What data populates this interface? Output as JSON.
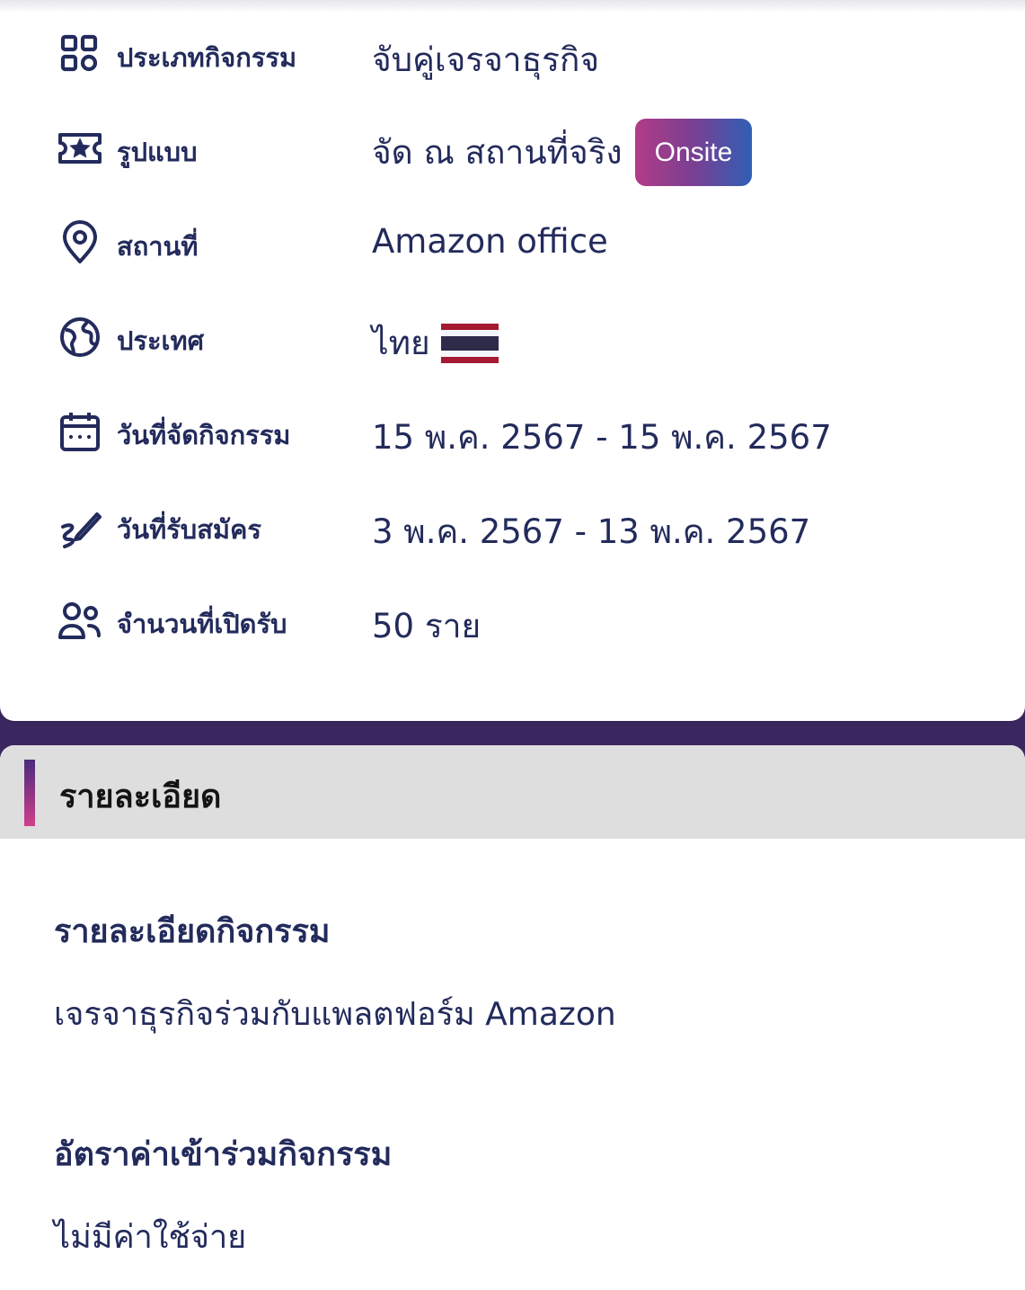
{
  "info": {
    "rows": [
      {
        "icon": "grid-icon",
        "label": "ประเภทกิจกรรม",
        "value": "จับคู่เจรจาธุรกิจ"
      },
      {
        "icon": "ticket-star-icon",
        "label": "รูปแบบ",
        "value": "จัด ณ สถานที่จริง",
        "badge": "Onsite"
      },
      {
        "icon": "location-pin-icon",
        "label": "สถานที่",
        "value": "Amazon office"
      },
      {
        "icon": "globe-icon",
        "label": "ประเทศ",
        "value": "ไทย"
      },
      {
        "icon": "calendar-icon",
        "label": "วันที่จัดกิจกรรม",
        "value": "15 พ.ค. 2567 - 15 พ.ค. 2567"
      },
      {
        "icon": "signature-pen-icon",
        "label": "วันที่รับสมัคร",
        "value": "3 พ.ค. 2567 - 13 พ.ค. 2567"
      },
      {
        "icon": "users-icon",
        "label": "จำนวนที่เปิดรับ",
        "value": "50 ราย"
      }
    ]
  },
  "details": {
    "title": "รายละเอียด",
    "activity_heading": "รายละเอียดกิจกรรม",
    "activity_text": "เจรจาธุรกิจร่วมกับแพลตฟอร์ม Amazon",
    "fee_heading": "อัตราค่าเข้าร่วมกิจกรรม",
    "fee_text": "ไม่มีค่าใช้จ่าย"
  },
  "colors": {
    "text_primary": "#232b5c",
    "band": "#3b275f",
    "header_bg": "#dedede",
    "badge_gradient": [
      "#b23c86",
      "#2f5fb4"
    ]
  }
}
